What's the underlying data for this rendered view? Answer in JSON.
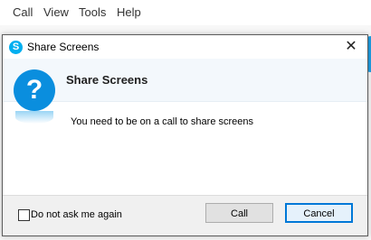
{
  "menubar": {
    "items": [
      "Call",
      "View",
      "Tools",
      "Help"
    ]
  },
  "dialog": {
    "window_title": "Share Screens",
    "close_glyph": "✕",
    "icon": "question-icon",
    "icon_glyph": "?",
    "app_icon_glyph": "S",
    "heading": "Share Screens",
    "message": "You need to be on a call to share screens",
    "checkbox_label": "Do not ask me again",
    "checkbox_checked": false,
    "buttons": {
      "call": "Call",
      "cancel": "Cancel"
    }
  },
  "colors": {
    "accent": "#0a8ede",
    "skype_blue": "#00aff0",
    "default_button_border": "#0078d7"
  }
}
